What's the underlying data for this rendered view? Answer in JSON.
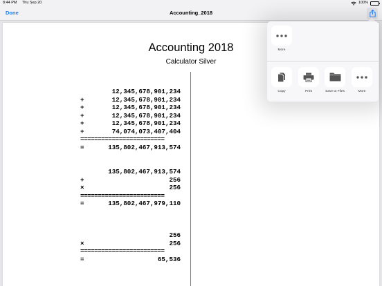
{
  "status_bar": {
    "time": "8:44 PM",
    "date": "Thu Sep 20",
    "battery": "100%"
  },
  "nav": {
    "done_label": "Done",
    "title": "Accounting_2018"
  },
  "document": {
    "title": "Accounting 2018",
    "subtitle": "Calculator Silver",
    "calculations": [
      {
        "rows": [
          {
            "op": "",
            "value": "12,345,678,901,234"
          },
          {
            "op": "+",
            "value": "12,345,678,901,234"
          },
          {
            "op": "+",
            "value": "12,345,678,901,234"
          },
          {
            "op": "+",
            "value": "12,345,678,901,234"
          },
          {
            "op": "+",
            "value": "12,345,678,901,234"
          },
          {
            "op": "+",
            "value": "74,074,073,407,404"
          }
        ],
        "separator": "========================",
        "result": {
          "op": "=",
          "value": "135,802,467,913,574"
        }
      },
      {
        "rows": [
          {
            "op": "",
            "value": "135,802,467,913,574"
          },
          {
            "op": "+",
            "value": "256"
          },
          {
            "op": "×",
            "value": "256"
          }
        ],
        "separator": "========================",
        "result": {
          "op": "=",
          "value": "135,802,467,979,110"
        }
      },
      {
        "rows": [
          {
            "op": "",
            "value": "256"
          },
          {
            "op": "×",
            "value": "256"
          }
        ],
        "separator": "========================",
        "result": {
          "op": "=",
          "value": "65,536"
        }
      }
    ]
  },
  "share_sheet": {
    "top_actions": [
      {
        "label": "More",
        "icon": "more-icon"
      }
    ],
    "actions": [
      {
        "label": "Copy",
        "icon": "copy-icon"
      },
      {
        "label": "Print",
        "icon": "printer-icon"
      },
      {
        "label": "Save to Files",
        "icon": "folder-icon"
      },
      {
        "label": "More",
        "icon": "more-icon"
      }
    ]
  },
  "colors": {
    "accent": "#1a7cf2"
  }
}
